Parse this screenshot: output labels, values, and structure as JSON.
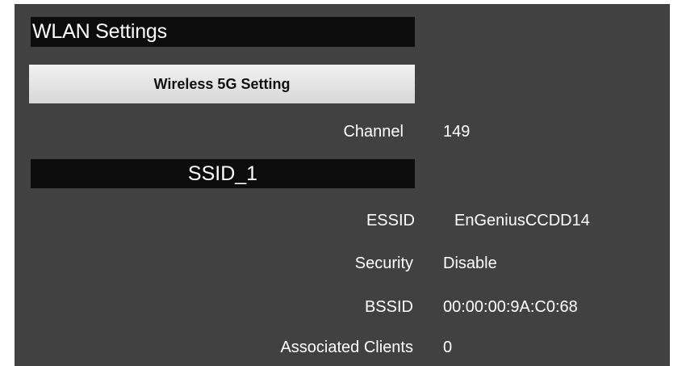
{
  "header": {
    "title": "WLAN Settings"
  },
  "tabs": [
    {
      "label": "Wireless 5G Setting"
    }
  ],
  "channel": {
    "label": "Channel",
    "value": "149"
  },
  "ssid_section": {
    "title": "SSID_1",
    "rows": [
      {
        "label": "ESSID",
        "value": "EnGeniusCCDD14"
      },
      {
        "label": "Security",
        "value": "Disable"
      },
      {
        "label": "BSSID",
        "value": "00:00:00:9A:C0:68"
      },
      {
        "label": "Associated Clients",
        "value": "0"
      }
    ]
  }
}
